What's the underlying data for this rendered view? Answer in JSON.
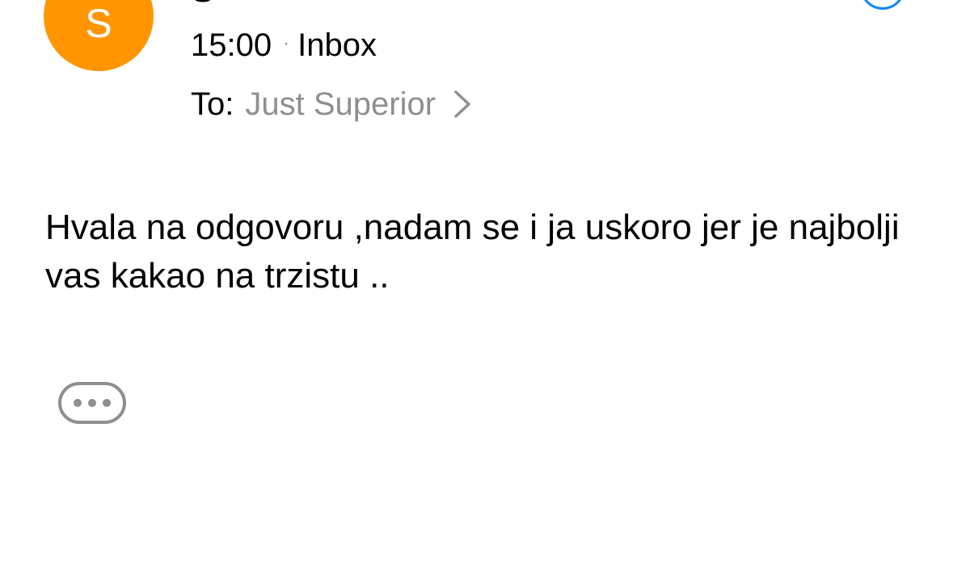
{
  "message": {
    "avatar": {
      "initial": "S",
      "color": "#FF9500"
    },
    "sender_name": "S···",
    "time": "15:00",
    "separator": "·",
    "mailbox": "Inbox",
    "to_label": "To:",
    "recipient": "Just Superior",
    "body": "Hvala na odgovoru ,nadam se i ja uskoro jer je najbolji vas kakao na trzistu .."
  },
  "icons": {
    "chevron": "chevron-right-icon",
    "more": "ellipsis-icon",
    "status": "circle-icon"
  },
  "colors": {
    "accent": "#0A84FF",
    "secondary_text": "#8e8e93",
    "avatar": "#FF9500"
  }
}
